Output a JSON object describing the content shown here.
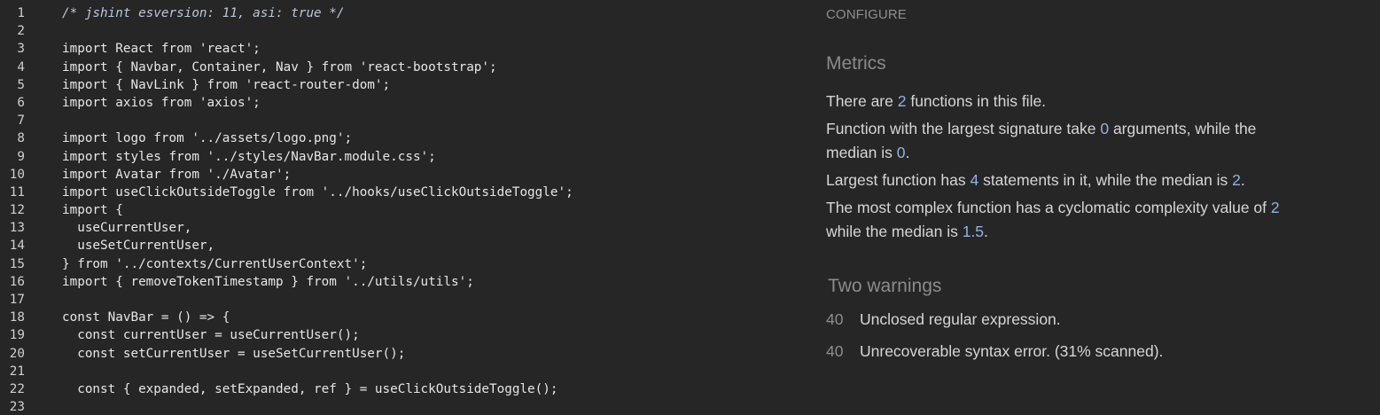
{
  "editor": {
    "lines": [
      {
        "n": "1",
        "code": "/* jshint esversion: 11, asi: true */"
      },
      {
        "n": "2",
        "code": ""
      },
      {
        "n": "3",
        "code": "import React from 'react';"
      },
      {
        "n": "4",
        "code": "import { Navbar, Container, Nav } from 'react-bootstrap';"
      },
      {
        "n": "5",
        "code": "import { NavLink } from 'react-router-dom';"
      },
      {
        "n": "6",
        "code": "import axios from 'axios';"
      },
      {
        "n": "7",
        "code": ""
      },
      {
        "n": "8",
        "code": "import logo from '../assets/logo.png';"
      },
      {
        "n": "9",
        "code": "import styles from '../styles/NavBar.module.css';"
      },
      {
        "n": "10",
        "code": "import Avatar from './Avatar';"
      },
      {
        "n": "11",
        "code": "import useClickOutsideToggle from '../hooks/useClickOutsideToggle';"
      },
      {
        "n": "12",
        "code": "import {"
      },
      {
        "n": "13",
        "code": "  useCurrentUser,"
      },
      {
        "n": "14",
        "code": "  useSetCurrentUser,"
      },
      {
        "n": "15",
        "code": "} from '../contexts/CurrentUserContext';"
      },
      {
        "n": "16",
        "code": "import { removeTokenTimestamp } from '../utils/utils';"
      },
      {
        "n": "17",
        "code": ""
      },
      {
        "n": "18",
        "code": "const NavBar = () => {"
      },
      {
        "n": "19",
        "code": "  const currentUser = useCurrentUser();"
      },
      {
        "n": "20",
        "code": "  const setCurrentUser = useSetCurrentUser();"
      },
      {
        "n": "21",
        "code": ""
      },
      {
        "n": "22",
        "code": "  const { expanded, setExpanded, ref } = useClickOutsideToggle();"
      },
      {
        "n": "23",
        "code": ""
      }
    ]
  },
  "report": {
    "configure_label": "CONFIGURE",
    "metrics_title": "Metrics",
    "metrics": {
      "p1_a": "There are ",
      "p1_num": "2",
      "p1_b": " functions in this file.",
      "p2_a": "Function with the largest signature take ",
      "p2_num1": "0",
      "p2_b": " arguments, while the median is ",
      "p2_num2": "0",
      "p2_c": ".",
      "p3_a": "Largest function has ",
      "p3_num1": "4",
      "p3_b": " statements in it, while the median is ",
      "p3_num2": "2",
      "p3_c": ".",
      "p4_a": "The most complex function has a cyclomatic complexity value of ",
      "p4_num1": "2",
      "p4_b": " while the median is ",
      "p4_num2": "1.5",
      "p4_c": "."
    },
    "warnings_title": "Two warnings",
    "warnings": [
      {
        "line": "40",
        "message": "Unclosed regular expression."
      },
      {
        "line": "40",
        "message": "Unrecoverable syntax error. (31% scanned)."
      }
    ]
  },
  "colors": {
    "background": "#262626",
    "number_accent": "#8fb3e6",
    "muted_heading": "#8b8b8b"
  }
}
